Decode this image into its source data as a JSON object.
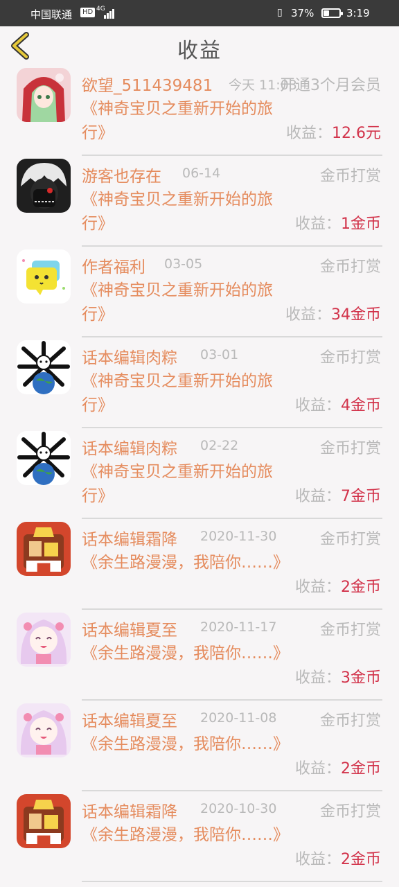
{
  "status_bar": {
    "carrier": "中国联通",
    "hd_badge": "HD",
    "network": "4G",
    "battery_percent": "37%",
    "battery_level": 0.37,
    "time": "3:19"
  },
  "header": {
    "title": "收益"
  },
  "income_label": "收益：",
  "records": [
    {
      "name": "欲望_511439481",
      "date": "今天 11:03",
      "type": "开通3个月会员",
      "book": "《神奇宝贝之重新开始的旅行》",
      "amount": "12.6元",
      "avatar": "red-hood-girl-avatar"
    },
    {
      "name": "游客也存在",
      "date": "06-14",
      "type": "金币打赏",
      "book": "《神奇宝贝之重新开始的旅行》",
      "amount": "1金币",
      "avatar": "masked-boy-avatar"
    },
    {
      "name": "作者福利",
      "date": "03-05",
      "type": "金币打赏",
      "book": "《神奇宝贝之重新开始的旅行》",
      "amount": "34金币",
      "avatar": "chat-bubble-avatar"
    },
    {
      "name": "话本编辑肉粽",
      "date": "03-01",
      "type": "金币打赏",
      "book": "《神奇宝贝之重新开始的旅行》",
      "amount": "4金币",
      "avatar": "bone-earth-avatar"
    },
    {
      "name": "话本编辑肉粽",
      "date": "02-22",
      "type": "金币打赏",
      "book": "《神奇宝贝之重新开始的旅行》",
      "amount": "7金币",
      "avatar": "bone-earth-avatar"
    },
    {
      "name": "话本编辑霜降",
      "date": "2020-11-30",
      "type": "金币打赏",
      "book": "《余生路漫漫，我陪你……》",
      "amount": "2金币",
      "avatar": "orange-character-avatar"
    },
    {
      "name": "话本编辑夏至",
      "date": "2020-11-17",
      "type": "金币打赏",
      "book": "《余生路漫漫，我陪你……》",
      "amount": "3金币",
      "avatar": "pink-anime-girl-avatar"
    },
    {
      "name": "话本编辑夏至",
      "date": "2020-11-08",
      "type": "金币打赏",
      "book": "《余生路漫漫，我陪你……》",
      "amount": "2金币",
      "avatar": "pink-anime-girl-avatar"
    },
    {
      "name": "话本编辑霜降",
      "date": "2020-10-30",
      "type": "金币打赏",
      "book": "《余生路漫漫，我陪你……》",
      "amount": "2金币",
      "avatar": "orange-character-avatar"
    }
  ]
}
